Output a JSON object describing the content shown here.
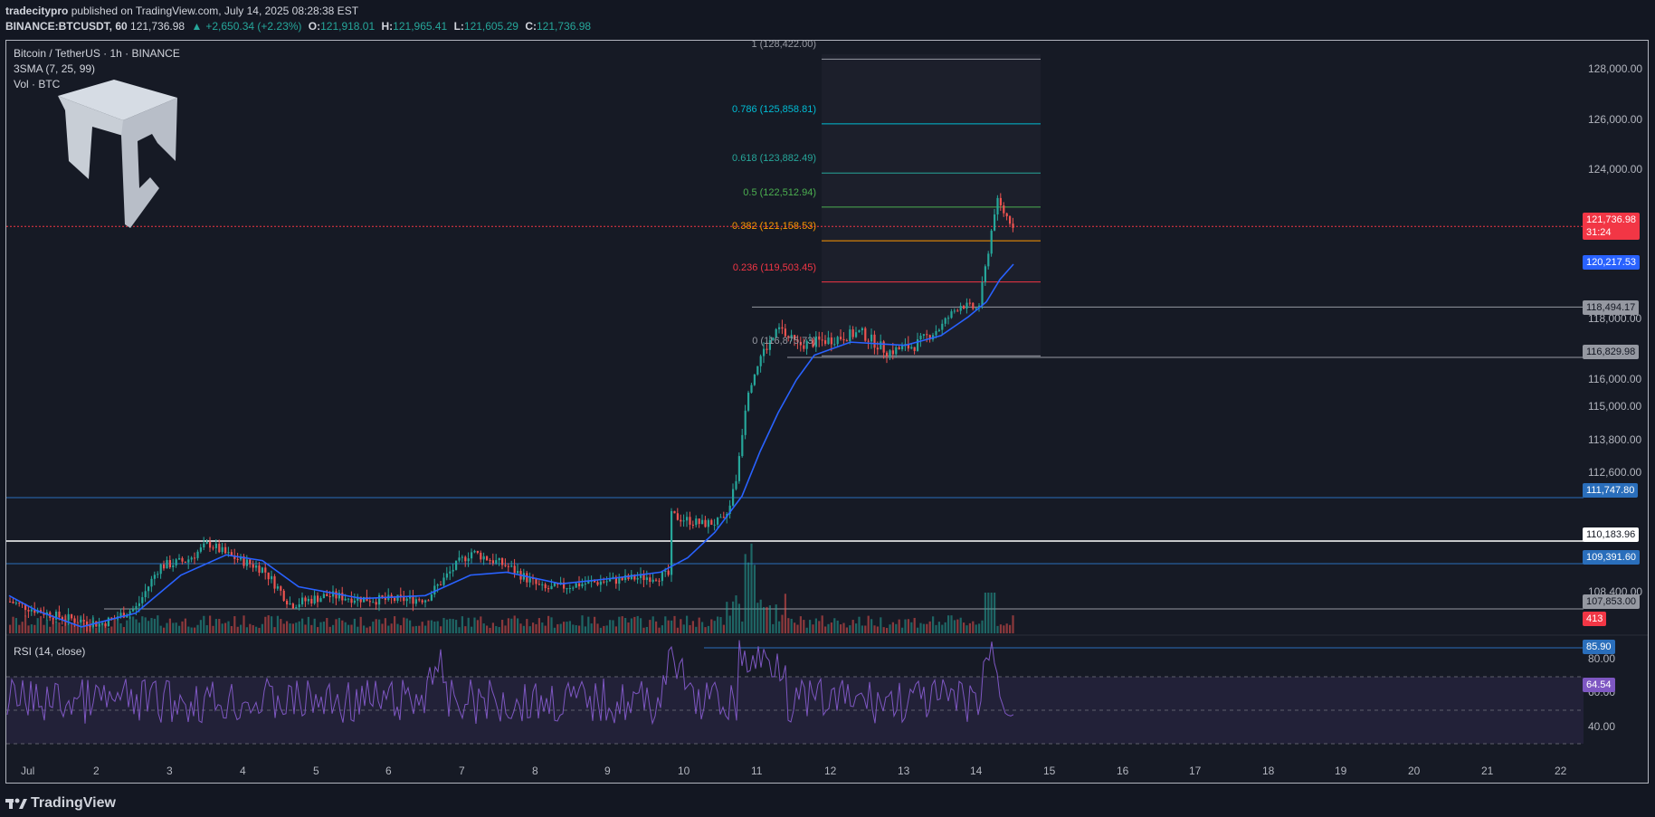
{
  "header": {
    "publisher": "tradecitypro",
    "published_text": "published on TradingView.com, July 14, 2025 08:28:38 EST",
    "symbol": "BINANCE:BTCUSDT, 60",
    "last": "121,736.98",
    "change": "+2,650.34 (+2.23%)",
    "o_label": "O:",
    "o": "121,918.01",
    "h_label": "H:",
    "h": "121,965.41",
    "l_label": "L:",
    "l": "121,605.29",
    "c_label": "C:",
    "c": "121,736.98"
  },
  "legend": {
    "title": "Bitcoin / TetherUS · 1h · BINANCE",
    "sma": "3SMA (7, 25, 99)",
    "vol": "Vol · BTC",
    "rsi": "RSI (14, close)"
  },
  "fib_levels": [
    {
      "label": "1 (128,422.00)",
      "price": 128422,
      "color": "#9598a1"
    },
    {
      "label": "0.786 (125,858.81)",
      "price": 125858.81,
      "color": "#00bcd4"
    },
    {
      "label": "0.618 (123,882.49)",
      "price": 123882.49,
      "color": "#26a69a"
    },
    {
      "label": "0.5 (122,512.94)",
      "price": 122512.94,
      "color": "#4caf50"
    },
    {
      "label": "0.382 (121,158.53)",
      "price": 121158.53,
      "color": "#ff9800"
    },
    {
      "label": "0.236 (119,503.45)",
      "price": 119503.45,
      "color": "#f23645"
    },
    {
      "label": "0 (116,875.73)",
      "price": 116875.73,
      "color": "#9598a1"
    }
  ],
  "price_axis": [
    "128,000.00",
    "126,000.00",
    "124,000.00",
    "118,000.00",
    "116,000.00",
    "115,000.00",
    "113,800.00",
    "112,600.00",
    "108,400.00"
  ],
  "price_tags": [
    {
      "text": "121,736.98",
      "sub": "31:24",
      "bg": "#f23645",
      "fg": "#ffffff"
    },
    {
      "text": "120,217.53",
      "bg": "#2962ff",
      "fg": "#ffffff"
    },
    {
      "text": "118,494.17",
      "bg": "#9598a1",
      "fg": "#131722"
    },
    {
      "text": "116,829.98",
      "bg": "#9598a1",
      "fg": "#131722"
    },
    {
      "text": "111,747.80",
      "bg": "#2a6ebb",
      "fg": "#ffffff"
    },
    {
      "text": "110,183.96",
      "bg": "#ffffff",
      "fg": "#131722"
    },
    {
      "text": "109,391.60",
      "bg": "#2a6ebb",
      "fg": "#ffffff"
    },
    {
      "text": "107,853.00",
      "bg": "#9598a1",
      "fg": "#131722"
    },
    {
      "text": "413",
      "bg": "#f23645",
      "fg": "#ffffff"
    }
  ],
  "rsi_axis": [
    "80.00",
    "60.00",
    "40.00"
  ],
  "rsi_tags": [
    {
      "text": "85.90",
      "bg": "#2a6ebb",
      "fg": "#ffffff"
    },
    {
      "text": "64.54",
      "bg": "#7e57c2",
      "fg": "#ffffff"
    }
  ],
  "time_axis": [
    "Jul",
    "2",
    "3",
    "4",
    "5",
    "6",
    "7",
    "8",
    "9",
    "10",
    "11",
    "12",
    "13",
    "14",
    "15",
    "16",
    "17",
    "18",
    "19",
    "20",
    "21",
    "22"
  ],
  "footer": {
    "brand": "TradingView"
  },
  "colors": {
    "up": "#26a69a",
    "down": "#ef5350",
    "sma": "#2962ff",
    "rsi": "#7e57c2"
  }
}
